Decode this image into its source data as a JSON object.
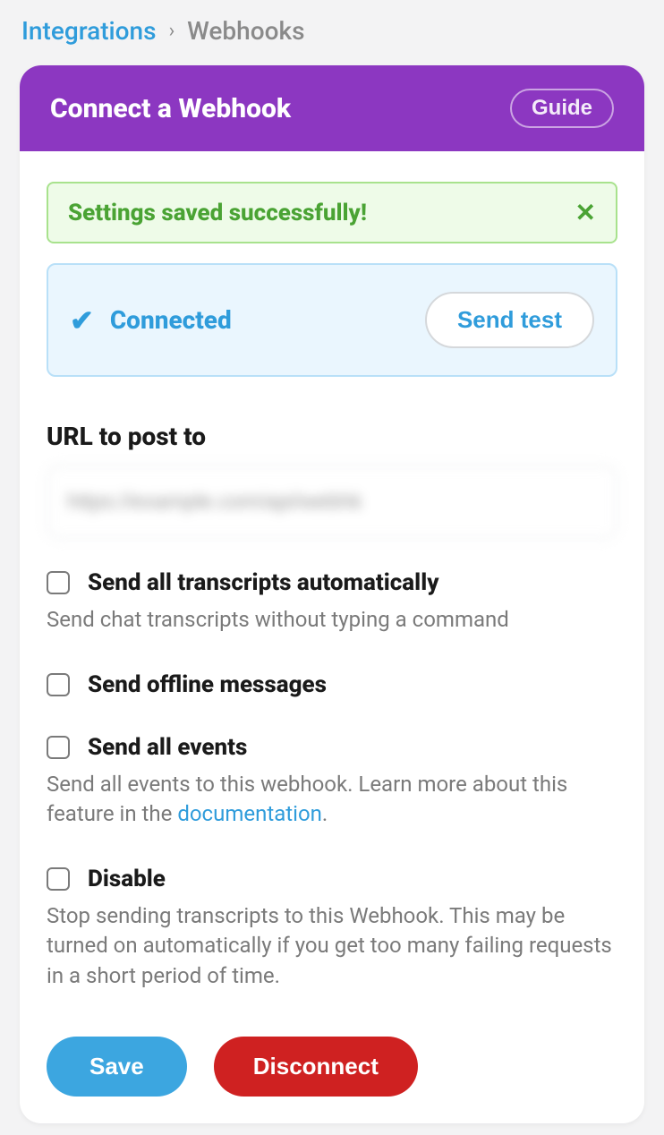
{
  "breadcrumb": {
    "parent": "Integrations",
    "separator": "›",
    "current": "Webhooks"
  },
  "header": {
    "title": "Connect a Webhook",
    "guide_label": "Guide"
  },
  "alert": {
    "message": "Settings saved successfully!",
    "close_glyph": "✕"
  },
  "status": {
    "check_glyph": "✔",
    "label": "Connected",
    "test_button": "Send test"
  },
  "url_field": {
    "label": "URL to post to",
    "value": "https://example.com/api/webhk"
  },
  "options": [
    {
      "title": "Send all transcripts automatically",
      "desc": "Send chat transcripts without typing a command"
    },
    {
      "title": "Send offline messages",
      "desc": ""
    },
    {
      "title": "Send all events",
      "desc_pre": "Send all events to this webhook. Learn more about this feature in the ",
      "desc_link": "documentation",
      "desc_post": "."
    },
    {
      "title": "Disable",
      "desc": "Stop sending transcripts to this Webhook. This may be turned on automatically if you get too many failing requests in a short period of time."
    }
  ],
  "actions": {
    "save": "Save",
    "disconnect": "Disconnect"
  }
}
